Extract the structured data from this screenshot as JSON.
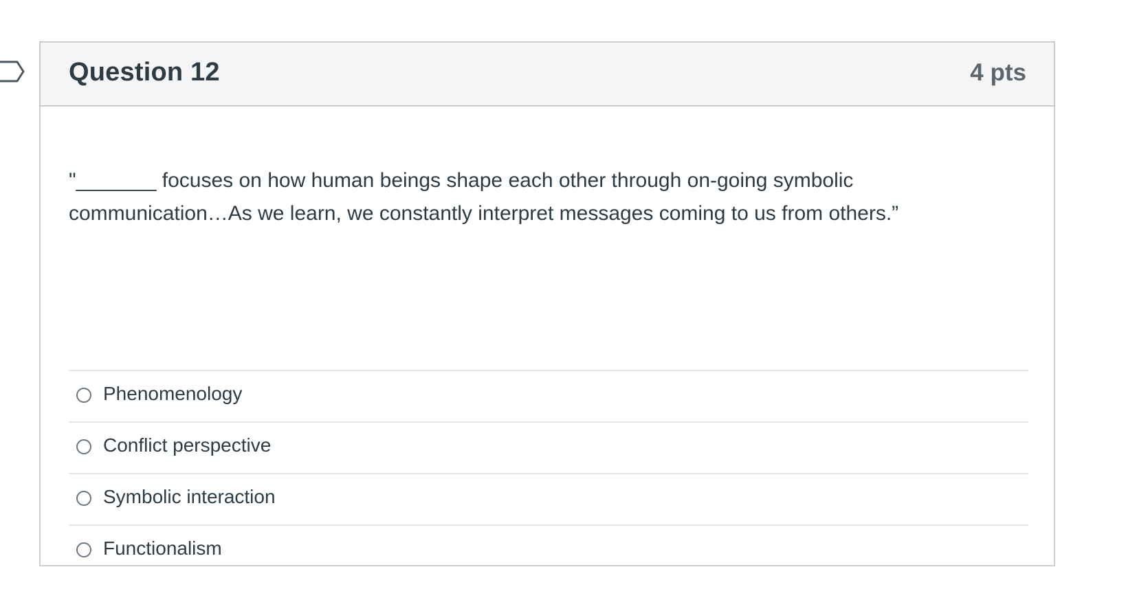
{
  "question": {
    "title": "Question 12",
    "points": "4 pts",
    "text": "\"_______ focuses on how human beings shape each other through on-going symbolic communication…As we learn, we constantly interpret messages coming to us from others.”",
    "flag_icon": "flag-outline-icon"
  },
  "answers": [
    {
      "label": "Phenomenology",
      "selected": false
    },
    {
      "label": "Conflict perspective",
      "selected": false
    },
    {
      "label": "Symbolic interaction",
      "selected": false
    },
    {
      "label": "Functionalism",
      "selected": false
    }
  ],
  "colors": {
    "border": "#c7cdd1",
    "header_bg": "#f5f5f5",
    "text": "#2d3b45",
    "points_text": "#5b6670",
    "divider": "#e3e6e8"
  }
}
